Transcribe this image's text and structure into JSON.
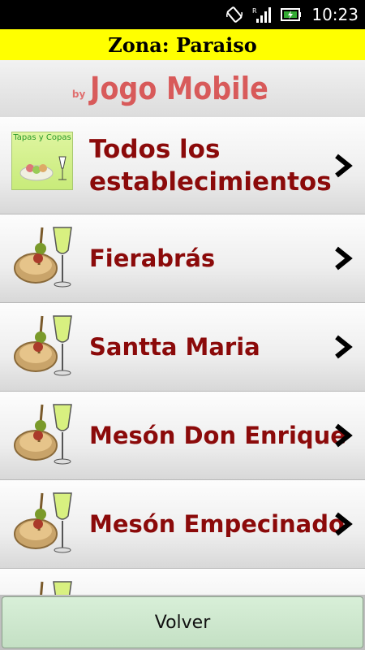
{
  "status_bar": {
    "time": "10:23",
    "icons": [
      "screen-rotate-icon",
      "signal-icon",
      "battery-icon"
    ]
  },
  "header": {
    "zone_title": "Zona: Paraiso",
    "brand_by": "by",
    "brand_name": "Jogo Mobile"
  },
  "list": {
    "items": [
      {
        "label": "Todos los establecimientos",
        "icon": "tapas-y-copas-logo",
        "logo_text": "Tapas y Copas"
      },
      {
        "label": "Fierabrás",
        "icon": "tapa-wine-icon"
      },
      {
        "label": "Santta Maria",
        "icon": "tapa-wine-icon"
      },
      {
        "label": "Mesón Don Enrique",
        "icon": "tapa-wine-icon"
      },
      {
        "label": "Mesón Empecinado",
        "icon": "tapa-wine-icon"
      }
    ]
  },
  "footer": {
    "back_label": "Volver"
  },
  "colors": {
    "zone_bar": "#ffff00",
    "item_text": "#8b0a0a",
    "brand": "#d85a5a",
    "button": "#c4e0c4"
  }
}
